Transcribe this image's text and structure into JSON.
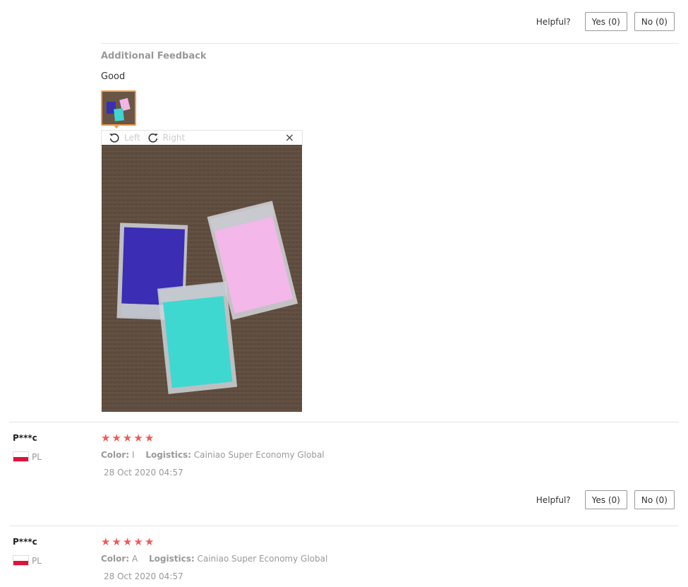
{
  "helpful": {
    "label": "Helpful?",
    "yes": "Yes (0)",
    "no": "No (0)"
  },
  "feedback": {
    "title": "Additional Feedback",
    "text": "Good"
  },
  "viewer": {
    "rotate_left": "Left",
    "rotate_right": "Right",
    "close": "×"
  },
  "reviews": [
    {
      "name": "P***c",
      "country": "PL",
      "rating": 5,
      "color_label": "Color:",
      "color_value": "I",
      "logistics_label": "Logistics:",
      "logistics_value": "Cainiao Super Economy Global",
      "date": "28 Oct 2020 04:57"
    },
    {
      "name": "P***c",
      "country": "PL",
      "rating": 5,
      "color_label": "Color:",
      "color_value": "A",
      "logistics_label": "Logistics:",
      "logistics_value": "Cainiao Super Economy Global",
      "date": "28 Oct 2020 04:57"
    }
  ],
  "icons": {
    "star": "★",
    "rotate_left": "rotate-left-icon",
    "rotate_right": "rotate-right-icon"
  },
  "colors": {
    "star": "#ef5a59",
    "thumb_border": "#f39c4b",
    "flag_red": "#dc143c"
  }
}
